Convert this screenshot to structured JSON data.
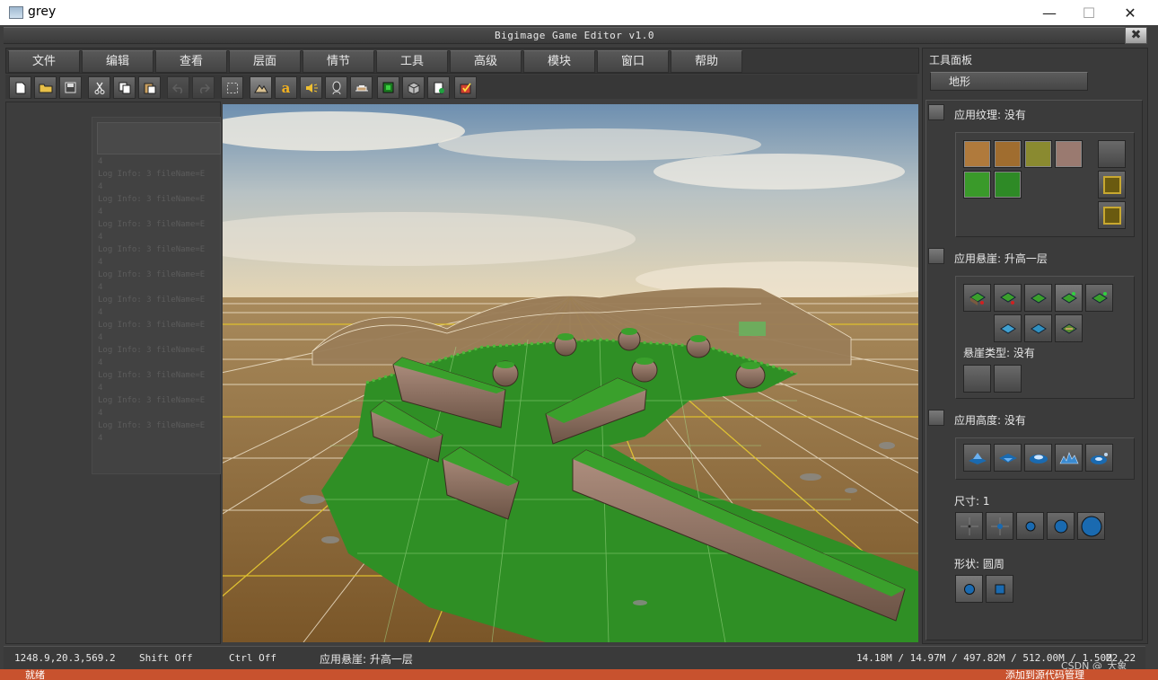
{
  "os_window": {
    "title": "grey",
    "minimize": "—",
    "maximize": "☐",
    "close": "✕"
  },
  "app": {
    "title": "Bigimage Game Editor v1.0",
    "close_glyph": "✖"
  },
  "menu": [
    "文件",
    "编辑",
    "查看",
    "层面",
    "情节",
    "工具",
    "高级",
    "模块",
    "窗口",
    "帮助"
  ],
  "toolbar": [
    "new-file-icon",
    "open-folder-icon",
    "save-icon",
    "cut-icon",
    "copy-icon",
    "paste-icon",
    "undo-icon",
    "redo-icon",
    "select-rect-icon",
    "terrain-icon",
    "text-a-icon",
    "sound-icon",
    "unit-icon",
    "doodad-icon",
    "region-icon",
    "camera-icon",
    "item-icon",
    "test-map-icon"
  ],
  "log": {
    "lines": [
      "4",
      "Log Info: 3  fileName=E",
      "4",
      "Log Info: 3  fileName=E",
      "4",
      "Log Info: 3  fileName=E",
      "4",
      "Log Info: 3  fileName=E",
      "4",
      "Log Info: 3  fileName=E",
      "4",
      "Log Info: 3  fileName=E",
      "4",
      "Log Info: 3  fileName=E",
      "4",
      "Log Info: 3  fileName=E",
      "4",
      "Log Info: 3  fileName=E",
      "4",
      "Log Info: 3  fileName=E",
      "4",
      "Log Info: 3  fileName=E",
      "4"
    ]
  },
  "panel": {
    "title": "工具面板",
    "tab": "地形",
    "texture_label": "应用纹理: 没有",
    "textures": [
      {
        "name": "dirt-texture",
        "color": "#b07a3c"
      },
      {
        "name": "rough-dirt-texture",
        "color": "#a06d2f"
      },
      {
        "name": "grassy-dirt-texture",
        "color": "#8a8a30"
      },
      {
        "name": "rock-texture",
        "color": "#9a7a70"
      },
      {
        "name": "grass-texture",
        "color": "#3a9a2a"
      },
      {
        "name": "dark-grass-texture",
        "color": "#2e8a26"
      }
    ],
    "cliff_label": "应用悬崖: 升高一层",
    "cliff_type_label": "悬崖类型: 没有",
    "height_label": "应用高度: 没有",
    "size_label": "尺寸: 1",
    "shape_label": "形状: 圆周"
  },
  "status": {
    "coords": "1248.9,20.3,569.2",
    "shift": "Shift Off",
    "ctrl": "Ctrl Off",
    "action": "应用悬崖: 升高一层",
    "memory": "14.18M / 14.97M / 497.82M / 512.00M / 1.50M",
    "fps": "22.22",
    "watermark": "CSDN @_大象_"
  },
  "os_bottom": {
    "left": "就绪",
    "right": "添加到源代码管理"
  },
  "colors": {
    "accent_blue": "#1a6ab0",
    "grid_yellow": "#e0c020",
    "grass": "#2f8f25"
  }
}
